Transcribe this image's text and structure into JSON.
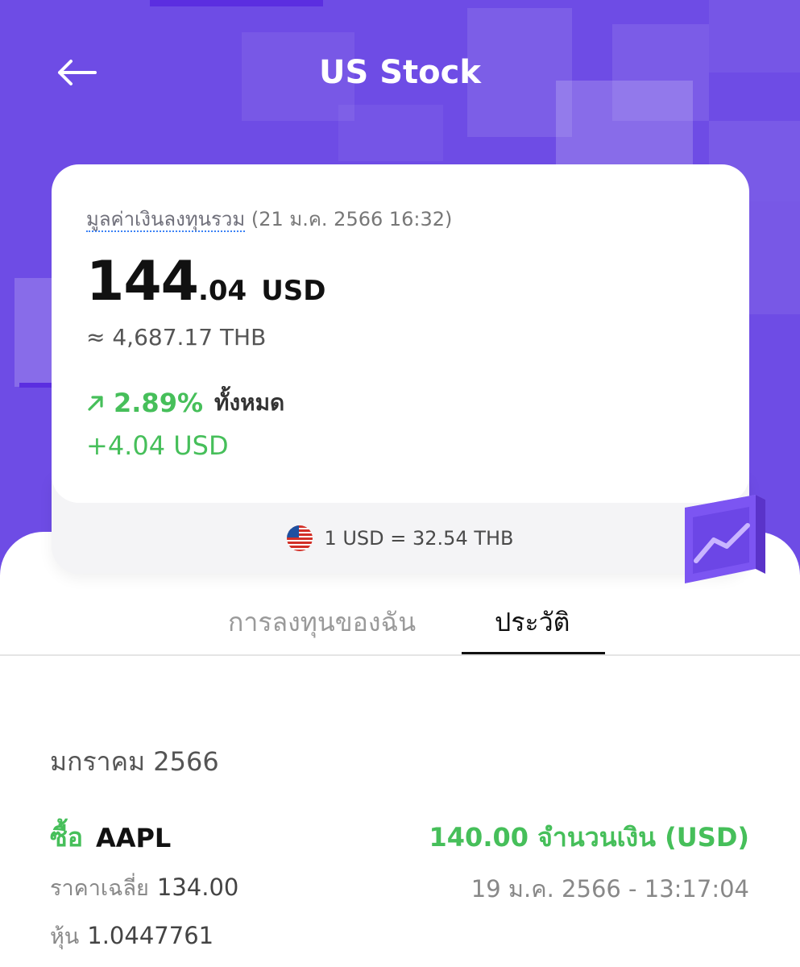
{
  "header": {
    "title": "US Stock"
  },
  "portfolio": {
    "label": "มูลค่าเงินลงทุนรวม",
    "timestamp": "(21 ม.ค. 2566 16:32)",
    "total_int": "144",
    "total_dec": ".04",
    "currency": "USD",
    "thb_value": "≈ 4,687.17 THB",
    "change_pct": "2.89%",
    "change_label": "ทั้งหมด",
    "change_usd": "+4.04 USD",
    "exchange_rate": "1 USD = 32.54 THB"
  },
  "tabs": [
    {
      "label": "การลงทุนของฉัน",
      "active": false
    },
    {
      "label": "ประวัติ",
      "active": true
    }
  ],
  "history": {
    "month": "มกราคม 2566",
    "transactions": [
      {
        "type": "ซื้อ",
        "symbol": "AAPL",
        "amount": "140.00 จำนวนเงิน (USD)",
        "avg_price_label": "ราคาเฉลี่ย",
        "avg_price": "134.00",
        "shares_label": "หุ้น",
        "shares": "1.0447761",
        "datetime": "19 ม.ค. 2566 - 13:17:04"
      }
    ]
  },
  "colors": {
    "header_bg": "#6e4ce5",
    "positive": "#46bf5a",
    "accent_dark": "#5b2ee0"
  },
  "icons": [
    "arrow-left-icon",
    "trend-up-arrow-icon",
    "us-flag-icon",
    "chart-box-icon"
  ]
}
